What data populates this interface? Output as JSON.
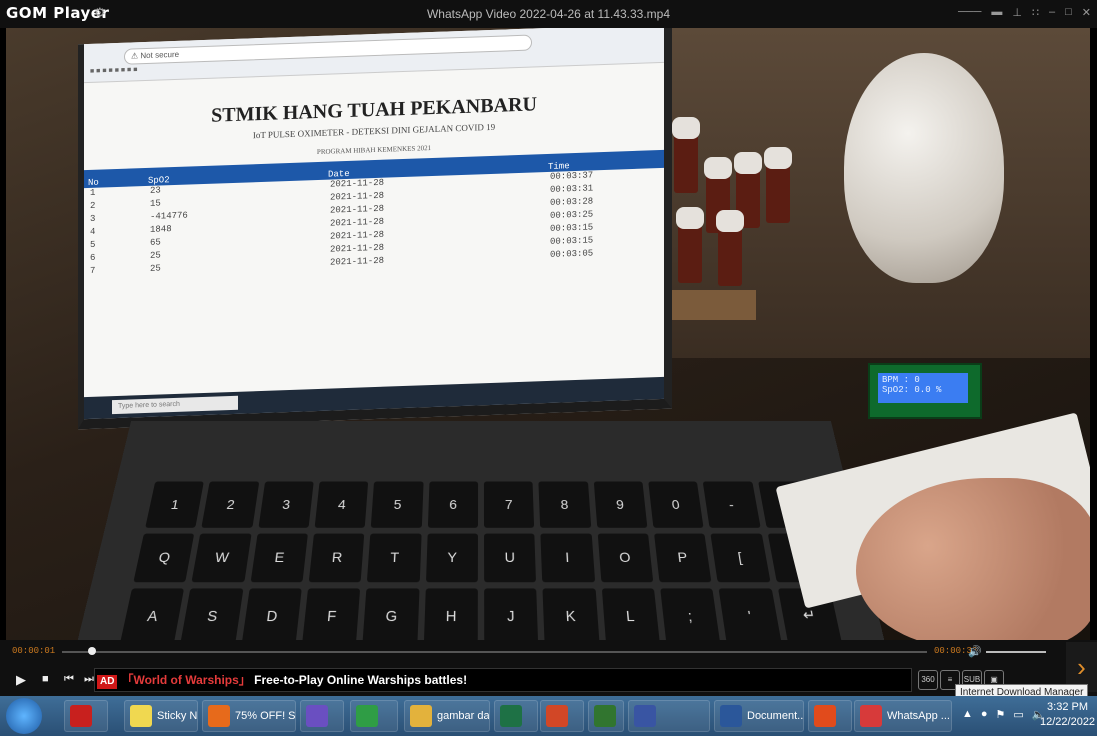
{
  "window": {
    "app_name": "GOM Player",
    "title": "WhatsApp Video 2022-04-26 at 11.43.33.mp4"
  },
  "video_frame": {
    "browser_address": "Not secure",
    "page_title": "STMIK HANG TUAH PEKANBARU",
    "page_subtitle": "IoT PULSE OXIMETER - DETEKSI DINI GEJALAN COVID 19",
    "page_program": "PROGRAM HIBAH KEMENKES 2021",
    "table_headers": [
      "No",
      "SpO2",
      "Date",
      "Time"
    ],
    "table_no": [
      "1",
      "2",
      "3",
      "4",
      "5",
      "6",
      "7"
    ],
    "table_spo2": [
      "23",
      "15",
      "-414776",
      "1848",
      "65",
      "25",
      "25"
    ],
    "table_date": [
      "2021-11-28",
      "2021-11-28",
      "2021-11-28",
      "2021-11-28",
      "2021-11-28",
      "2021-11-28",
      "2021-11-28"
    ],
    "table_time": [
      "00:03:37",
      "00:03:31",
      "00:03:28",
      "00:03:25",
      "00:03:15",
      "00:03:15",
      "00:03:05"
    ],
    "taskbar_search": "Type here to search",
    "lcd_line1": "BPM : 0",
    "lcd_line2": "SpO2: 0.0 %",
    "keyboard_keys": [
      "1",
      "2",
      "3",
      "4",
      "5",
      "6",
      "7",
      "8",
      "9",
      "0",
      "-",
      "=",
      "Q",
      "W",
      "E",
      "R",
      "T",
      "Y",
      "U",
      "I",
      "O",
      "P",
      "[",
      "]",
      "A",
      "S",
      "D",
      "F",
      "G",
      "H",
      "J",
      "K",
      "L",
      ";",
      "'",
      "↵"
    ]
  },
  "player": {
    "time_current": "00:00:01",
    "time_total": "00:00:36",
    "progress": 0.03,
    "ad_tag": "AD",
    "ad_game": "「World of Warships」",
    "ad_text": "Free-to-Play Online Warships battles!",
    "tooltip": "Internet Download Manager",
    "right_buttons": [
      "360",
      "≡",
      "SUB",
      "▣"
    ]
  },
  "taskbar": {
    "items": [
      {
        "label": "",
        "icon": "pdf-icon",
        "color": "#c8201e"
      },
      {
        "label": "Sticky Notes",
        "icon": "sticky-notes-icon",
        "color": "#f0d850"
      },
      {
        "label": "75% OFF! S...",
        "icon": "firefox-icon",
        "color": "#e76a1b"
      },
      {
        "label": "",
        "icon": "app-icon",
        "color": "#6a4fc1"
      },
      {
        "label": "",
        "icon": "chrome-icon",
        "color": "#2f9d45"
      },
      {
        "label": "gambar da...",
        "icon": "folder-icon",
        "color": "#e3b23c"
      },
      {
        "label": "",
        "icon": "excel-icon",
        "color": "#1e7145"
      },
      {
        "label": "",
        "icon": "powerpoint-icon",
        "color": "#d24726"
      },
      {
        "label": "",
        "icon": "project-icon",
        "color": "#31752f"
      },
      {
        "label": "",
        "icon": "visio-icon",
        "color": "#3955a3"
      },
      {
        "label": "Document...",
        "icon": "word-icon",
        "color": "#2b579a"
      },
      {
        "label": "",
        "icon": "idm-icon",
        "color": "#e14b1c"
      },
      {
        "label": "WhatsApp ...",
        "icon": "gom-icon",
        "color": "#d73a3a"
      }
    ],
    "clock_time": "3:32 PM",
    "clock_date": "12/22/2022"
  }
}
